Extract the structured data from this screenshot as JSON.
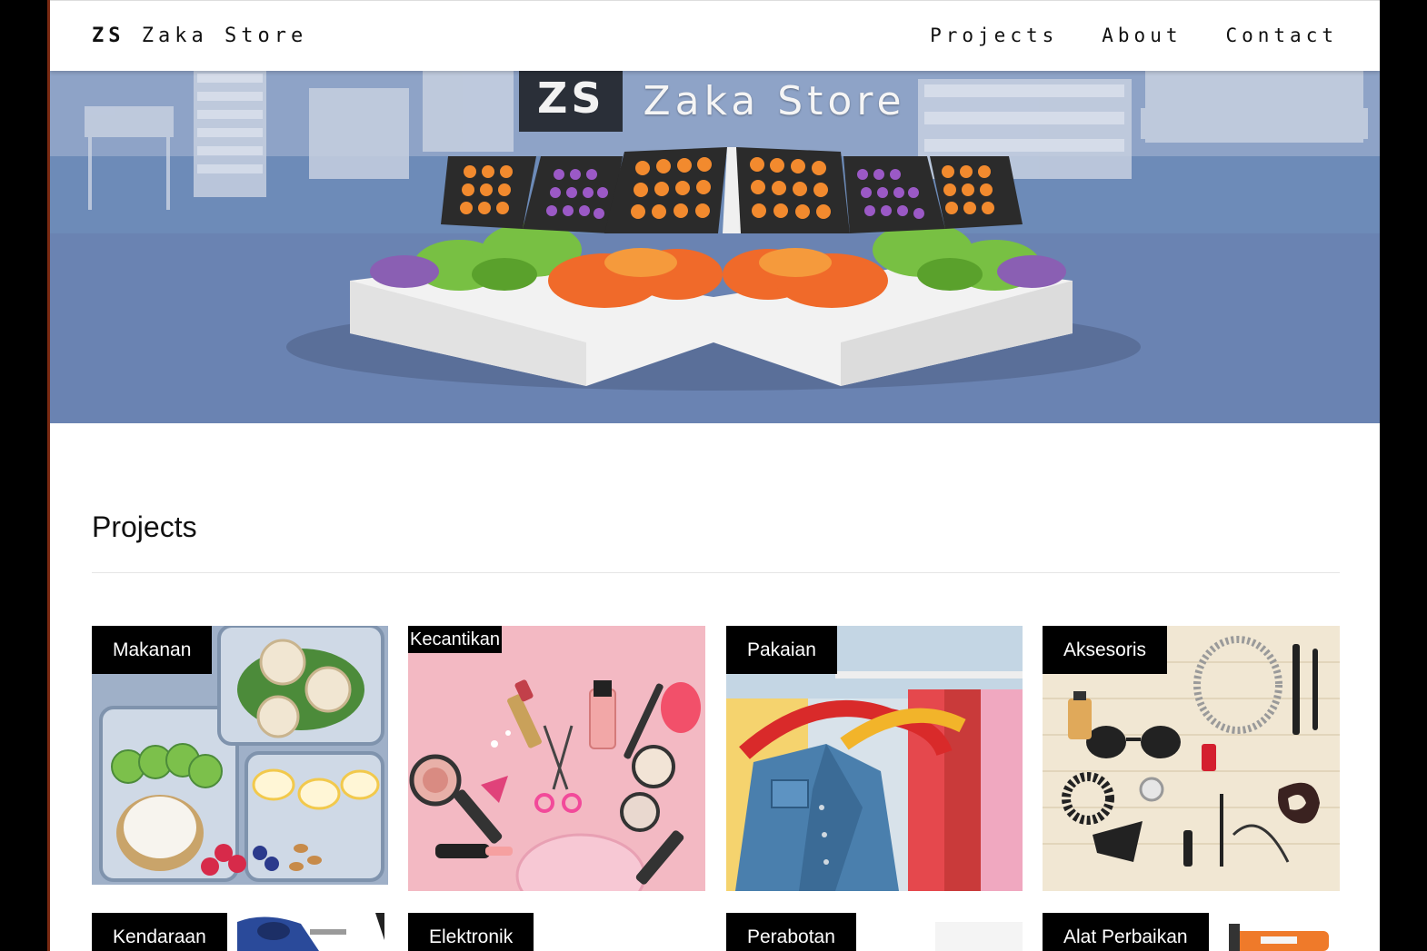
{
  "navbar": {
    "brand_bold": "ZS",
    "brand_rest": "Zaka Store",
    "links": [
      "Projects",
      "About",
      "Contact"
    ]
  },
  "hero": {
    "badge": "ZS",
    "title": "Zaka Store"
  },
  "section": {
    "title": "Projects"
  },
  "cards": [
    {
      "label": "Makanan",
      "icon": "food-boxes"
    },
    {
      "label": "Kecantikan",
      "icon": "cosmetics"
    },
    {
      "label": "Pakaian",
      "icon": "clothes-rack"
    },
    {
      "label": "Aksesoris",
      "icon": "accessories"
    },
    {
      "label": "Kendaraan",
      "icon": "vehicle"
    },
    {
      "label": "Elektronik",
      "icon": "electronics"
    },
    {
      "label": "Perabotan",
      "icon": "furniture"
    },
    {
      "label": "Alat Perbaikan",
      "icon": "repair-tools"
    }
  ],
  "colors": {
    "hero_bg": "#6a85b6",
    "badge_bg": "#2a2f38",
    "label_bg": "#000000",
    "page_bg": "#ffffff"
  }
}
